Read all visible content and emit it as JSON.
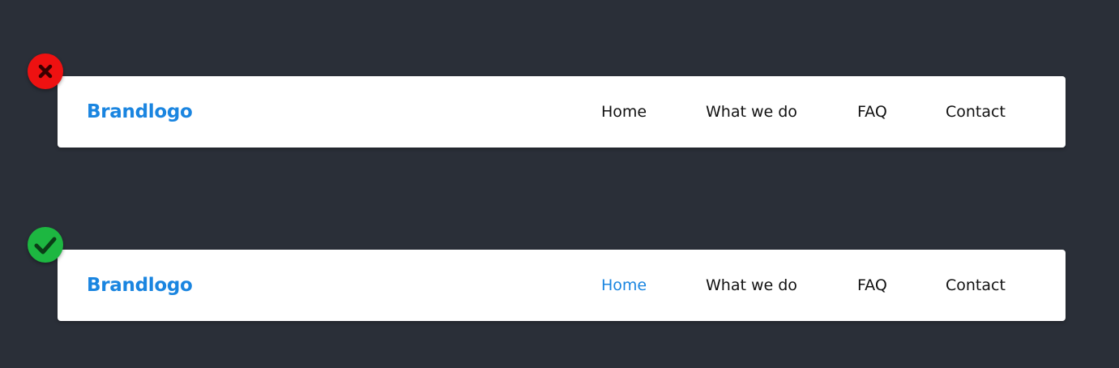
{
  "colors": {
    "background": "#2a2f38",
    "navbar_bg": "#ffffff",
    "brand": "#1a85e0",
    "active_link": "#1a85e0",
    "link": "#111111",
    "incorrect_badge": "#ee1111",
    "correct_badge": "#1db741"
  },
  "examples": {
    "incorrect": {
      "status_icon": "x-icon",
      "navbar": {
        "brand": "Brandlogo",
        "links": [
          "Home",
          "What we do",
          "FAQ",
          "Contact"
        ],
        "active_link": ""
      }
    },
    "correct": {
      "status_icon": "checkmark-icon",
      "navbar": {
        "brand": "Brandlogo",
        "links": [
          "Home",
          "What we do",
          "FAQ",
          "Contact"
        ],
        "active_link": "Home"
      }
    }
  }
}
